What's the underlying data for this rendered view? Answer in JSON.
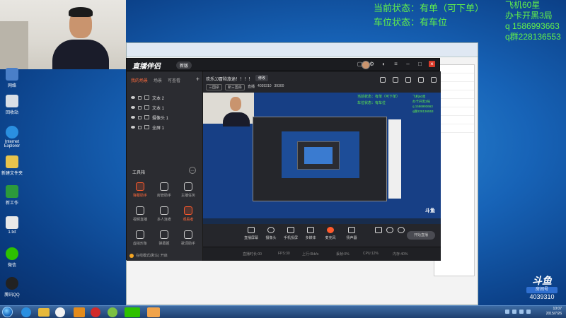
{
  "overlay": {
    "order_status": "当前状态：有单（可下单）",
    "seat_status": "车位状态：有车位",
    "contact_lines": [
      "飞机60星",
      "办卡开黑3局",
      "q 1586993663",
      "q群228136553"
    ]
  },
  "desktop_icons": [
    {
      "label": "网络",
      "color": "#4a7fc8"
    },
    {
      "label": "回收站",
      "color": "#d9dfe6"
    },
    {
      "label": "Internet Explorer",
      "color": "#2a8fe0"
    },
    {
      "label": "新建文件夹",
      "color": "#e7c34c"
    },
    {
      "label": "新工作",
      "color": "#2c9a3c"
    },
    {
      "label": "1.txt",
      "color": "#e8e8e8"
    },
    {
      "label": "微信",
      "color": "#2dc100"
    },
    {
      "label": "腾讯QQ",
      "color": "#222222"
    }
  ],
  "app": {
    "logo": "直播伴侣",
    "badge": "新版",
    "scene_tabs": [
      "我的场景",
      "场景",
      "可查看"
    ],
    "sources": [
      {
        "label": "文本 2"
      },
      {
        "label": "文本 1"
      },
      {
        "label": "摄像头 1"
      },
      {
        "label": "全屏 1"
      }
    ],
    "tools_title": "工具箱",
    "tools": [
      {
        "label": "弹幕助手",
        "hot": true
      },
      {
        "label": "房管助手",
        "hot": false
      },
      {
        "label": "主播任务",
        "hot": false
      },
      {
        "label": "视频直播",
        "hot": false
      },
      {
        "label": "多人连麦",
        "hot": false
      },
      {
        "label": "观看者",
        "hot": true
      },
      {
        "label": "虚拟形象",
        "hot": false
      },
      {
        "label": "弹幕姬",
        "hot": false
      },
      {
        "label": "歌词助手",
        "hot": false
      }
    ],
    "notice": "在线模式(默认) 开启",
    "room_title": "欢乐JJ冒险旅途！！！！",
    "edit_label": "修改",
    "categories": [
      "三国杀",
      "新三国杀"
    ],
    "stats": [
      "直播",
      "4039310",
      "39300"
    ],
    "preview_status": [
      "当前状态：有单（可下单）",
      "车位状态：有车位"
    ],
    "preview_contact": [
      "飞机60星",
      "办卡开黑3局",
      "q 1586993663",
      "q群228136553"
    ],
    "preview_logo": "斗鱼",
    "controls": [
      "直播屏幕",
      "摄像头",
      "手机投屏",
      "多媒体",
      "麦克风",
      "扬声器"
    ],
    "start_label": "开始直播",
    "status_items": [
      "直播时长:00",
      "FPS:30",
      "上行:0kb/s",
      "丢帧:0%",
      "CPU:12%",
      "内存:40%"
    ]
  },
  "douyu": {
    "mark": "斗鱼",
    "room_label": "房间号",
    "room_number": "4039310"
  },
  "taskbar": {
    "time": "10:07",
    "date": "2015/7/26"
  }
}
